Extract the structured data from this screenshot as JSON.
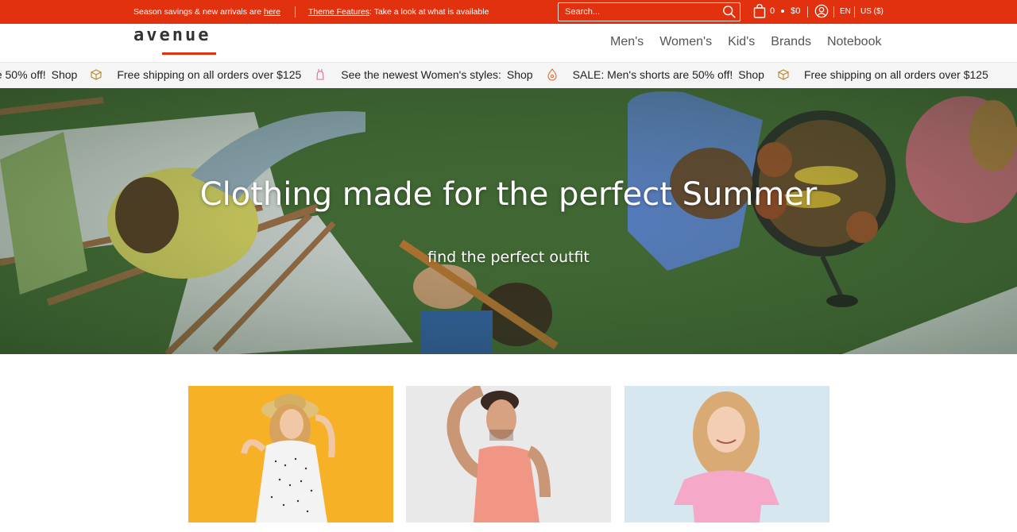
{
  "topbar": {
    "promo1_text": "Season savings & new arrivals are ",
    "promo1_link": "here",
    "promo2_link": "Theme Features",
    "promo2_text": ": Take a look at what is available",
    "search_placeholder": "Search...",
    "cart_count": "0",
    "cart_total": "$0",
    "language": "EN",
    "currency": "US ($)"
  },
  "header": {
    "logo": "avenue",
    "nav": [
      "Men's",
      "Women's",
      "Kid's",
      "Brands",
      "Notebook"
    ]
  },
  "ticker": {
    "items": [
      {
        "text": "SALE: Men's shorts are 50% off!",
        "link": "Shop",
        "icon": "box-icon"
      },
      {
        "text": "Free shipping on all orders over $125",
        "link": "",
        "icon": "dress-icon"
      },
      {
        "text": "See the newest Women's styles:",
        "link": "Shop",
        "icon": "tag-icon"
      },
      {
        "text": "SALE: Men's shorts are 50% off!",
        "link": "Shop",
        "icon": "box-icon"
      },
      {
        "text": "Free shipping on all orders over $125",
        "link": "",
        "icon": "dress-icon"
      }
    ]
  },
  "hero": {
    "title": "Clothing made for the perfect Summer",
    "subtitle": "find the perfect outfit"
  },
  "colors": {
    "brand_red": "#e2310e",
    "women_card_bg": "#f7b127",
    "men_card_bg": "#e9e9e9",
    "kids_card_bg": "#d6e7f0"
  }
}
